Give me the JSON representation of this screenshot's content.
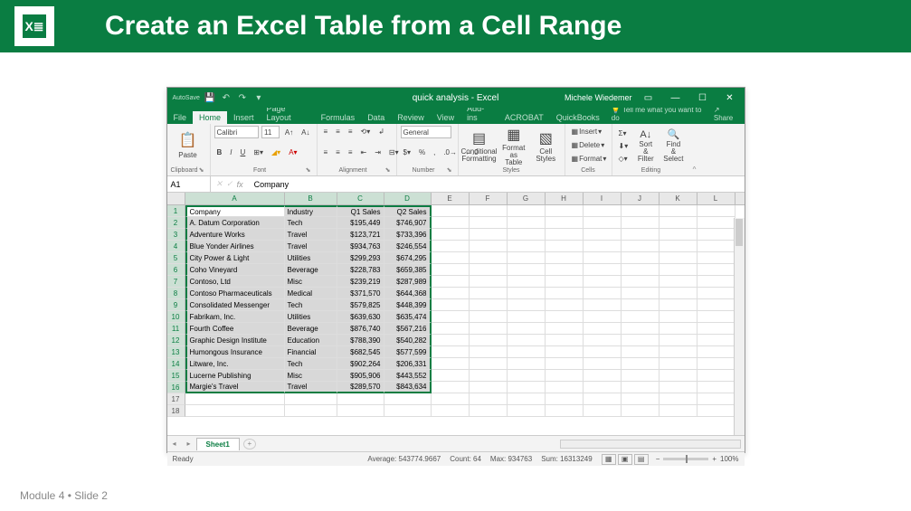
{
  "header": {
    "title": "Create an Excel Table from a Cell Range",
    "logo_text": "X≣"
  },
  "footer": "Module 4 • Slide 2",
  "titlebar": {
    "autosave": "AutoSave",
    "title": "quick analysis - Excel",
    "user": "Michele Wiedemer"
  },
  "tabs": [
    "File",
    "Home",
    "Insert",
    "Page Layout",
    "Formulas",
    "Data",
    "Review",
    "View",
    "Add-ins",
    "ACROBAT",
    "QuickBooks"
  ],
  "active_tab": 1,
  "tellme": "Tell me what you want to do",
  "share": "Share",
  "ribbon": {
    "clipboard": {
      "label": "Clipboard",
      "paste": "Paste"
    },
    "font": {
      "label": "Font",
      "name": "Calibri",
      "size": "11",
      "b": "B",
      "i": "I",
      "u": "U"
    },
    "alignment": {
      "label": "Alignment"
    },
    "number": {
      "label": "Number",
      "general": "General"
    },
    "styles": {
      "label": "Styles",
      "cf": "Conditional\nFormatting",
      "fat": "Format as\nTable",
      "cs": "Cell\nStyles"
    },
    "cells": {
      "label": "Cells",
      "insert": "Insert",
      "delete": "Delete",
      "format": "Format"
    },
    "editing": {
      "label": "Editing",
      "sort": "Sort &\nFilter",
      "find": "Find &\nSelect"
    }
  },
  "namebox": "A1",
  "formula": "Company",
  "columns": [
    "A",
    "B",
    "C",
    "D",
    "E",
    "F",
    "G",
    "H",
    "I",
    "J",
    "K",
    "L"
  ],
  "headers": [
    "Company",
    "Industry",
    "Q1 Sales",
    "Q2 Sales"
  ],
  "rows": [
    [
      "A. Datum Corporation",
      "Tech",
      "$195,449",
      "$746,907"
    ],
    [
      "Adventure Works",
      "Travel",
      "$123,721",
      "$733,396"
    ],
    [
      "Blue Yonder Airlines",
      "Travel",
      "$934,763",
      "$246,554"
    ],
    [
      "City Power & Light",
      "Utilities",
      "$299,293",
      "$674,295"
    ],
    [
      "Coho Vineyard",
      "Beverage",
      "$228,783",
      "$659,385"
    ],
    [
      "Contoso, Ltd",
      "Misc",
      "$239,219",
      "$287,989"
    ],
    [
      "Contoso Pharmaceuticals",
      "Medical",
      "$371,570",
      "$644,368"
    ],
    [
      "Consolidated Messenger",
      "Tech",
      "$579,825",
      "$448,399"
    ],
    [
      "Fabrikam, Inc.",
      "Utilities",
      "$639,630",
      "$635,474"
    ],
    [
      "Fourth Coffee",
      "Beverage",
      "$876,740",
      "$567,216"
    ],
    [
      "Graphic Design Institute",
      "Education",
      "$788,390",
      "$540,282"
    ],
    [
      "Humongous Insurance",
      "Financial",
      "$682,545",
      "$577,599"
    ],
    [
      "Litware, Inc.",
      "Tech",
      "$902,264",
      "$206,331"
    ],
    [
      "Lucerne Publishing",
      "Misc",
      "$905,906",
      "$443,552"
    ],
    [
      "Margie's Travel",
      "Travel",
      "$289,570",
      "$843,634"
    ]
  ],
  "sheet": "Sheet1",
  "status": {
    "ready": "Ready",
    "avg": "Average: 543774.9667",
    "count": "Count: 64",
    "max": "Max: 934763",
    "sum": "Sum: 16313249",
    "zoom": "100%"
  }
}
